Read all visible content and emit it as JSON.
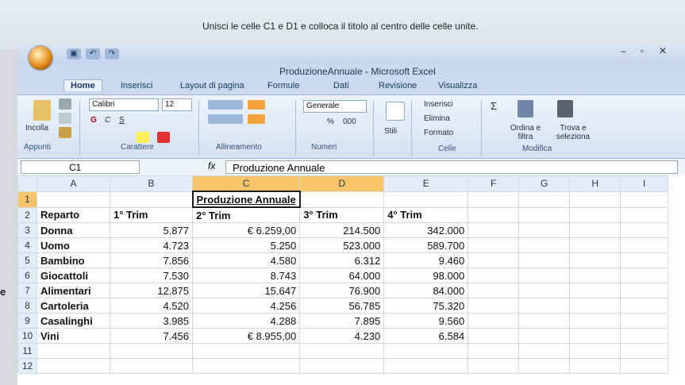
{
  "instruction_text": "Unisci le celle C1 e D1 e colloca il titolo al centro delle celle unite.",
  "left_margin_letter": "e",
  "window": {
    "title": "ProduzioneAnnuale - Microsoft Excel",
    "tabs": [
      "Home",
      "Inserisci",
      "Layout di pagina",
      "Formule",
      "Dati",
      "Revisione",
      "Visualizza"
    ],
    "active_tab": 0
  },
  "ribbon": {
    "clipboard": {
      "paste_label": "Incolla",
      "group_label": "Appunti"
    },
    "font": {
      "family": "Calibri",
      "size": "12",
      "bold": "G",
      "italic": "C",
      "underline": "S",
      "group_label": "Carattere"
    },
    "alignment": {
      "group_label": "Allineamento"
    },
    "number": {
      "format": "Generale",
      "percent": "%",
      "thousands": "000",
      "group_label": "Numeri"
    },
    "styles": {
      "label": "Stili"
    },
    "cells": {
      "insert": "Inserisci",
      "delete": "Elimina",
      "format": "Formato",
      "group_label": "Celle"
    },
    "editing": {
      "sort_label": "Ordina e filtra",
      "find_label": "Trova e seleziona",
      "group_label": "Modifica"
    }
  },
  "formula_bar": {
    "cell_ref": "C1",
    "fx": "fx",
    "content": "Produzione Annuale"
  },
  "columns": [
    "A",
    "B",
    "C",
    "D",
    "E",
    "F",
    "G",
    "H",
    "I"
  ],
  "rows": [
    [
      "1",
      "",
      "",
      "Produzione Annuale",
      "",
      "",
      "",
      "",
      "",
      ""
    ],
    [
      "2",
      "Reparto",
      "1° Trim",
      "2° Trim",
      "3° Trim",
      "4° Trim",
      "",
      "",
      "",
      ""
    ],
    [
      "3",
      "Donna",
      "5.877",
      "€ 6.259,00",
      "214.500",
      "342.000",
      "",
      "",
      "",
      ""
    ],
    [
      "4",
      "Uomo",
      "4.723",
      "5.250",
      "523.000",
      "589.700",
      "",
      "",
      "",
      ""
    ],
    [
      "5",
      "Bambino",
      "7.856",
      "4.580",
      "6.312",
      "9.460",
      "",
      "",
      "",
      ""
    ],
    [
      "6",
      "Giocattoli",
      "7.530",
      "8.743",
      "64.000",
      "98.000",
      "",
      "",
      "",
      ""
    ],
    [
      "7",
      "Alimentari",
      "12.875",
      "15.647",
      "76.900",
      "84.000",
      "",
      "",
      "",
      ""
    ],
    [
      "8",
      "Cartoleria",
      "4.520",
      "4.256",
      "56.785",
      "75.320",
      "",
      "",
      "",
      ""
    ],
    [
      "9",
      "Casalinghi",
      "3.985",
      "4.288",
      "7.895",
      "9.560",
      "",
      "",
      "",
      ""
    ],
    [
      "10",
      "Vini",
      "7.456",
      "€ 8.955,00",
      "4.230",
      "6.584",
      "",
      "",
      "",
      ""
    ],
    [
      "11",
      "",
      "",
      "",
      "",
      "",
      "",
      "",
      "",
      ""
    ],
    [
      "12",
      "",
      "",
      "",
      "",
      "",
      "",
      "",
      "",
      ""
    ]
  ],
  "colors": {
    "selection_header": "#f7c46a",
    "header_bg": "#e4ecf7",
    "ribbon_bg": "#d4e1f2"
  }
}
